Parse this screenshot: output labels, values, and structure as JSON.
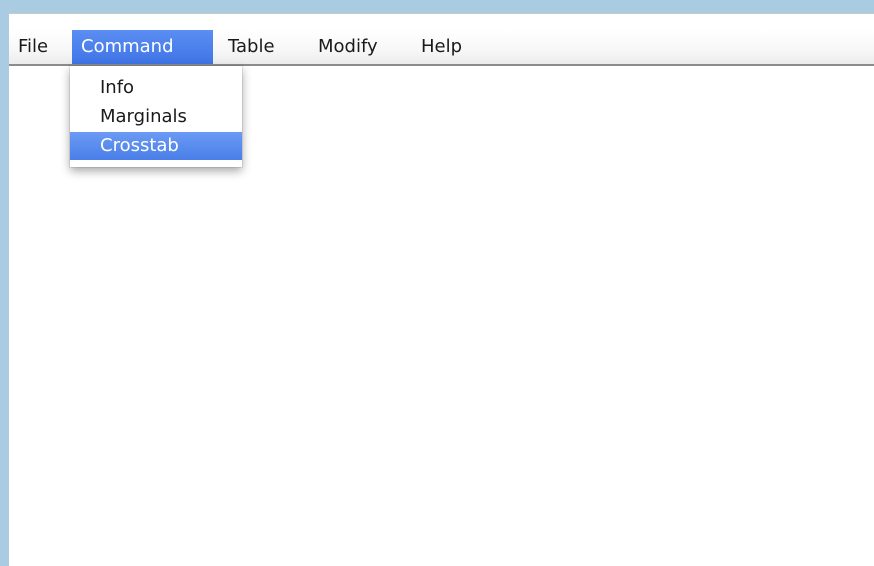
{
  "menubar": {
    "items": [
      {
        "label": "File"
      },
      {
        "label": "Command"
      },
      {
        "label": "Table"
      },
      {
        "label": "Modify"
      },
      {
        "label": "Help"
      }
    ],
    "active": "Command"
  },
  "dropdown": {
    "items": [
      {
        "label": "Info"
      },
      {
        "label": "Marginals"
      },
      {
        "label": "Crosstab"
      }
    ],
    "highlighted": "Crosstab"
  },
  "colors": {
    "desktop_background": "#a9cce3",
    "selection": "#4a7fe8",
    "window_background": "#ffffff"
  }
}
